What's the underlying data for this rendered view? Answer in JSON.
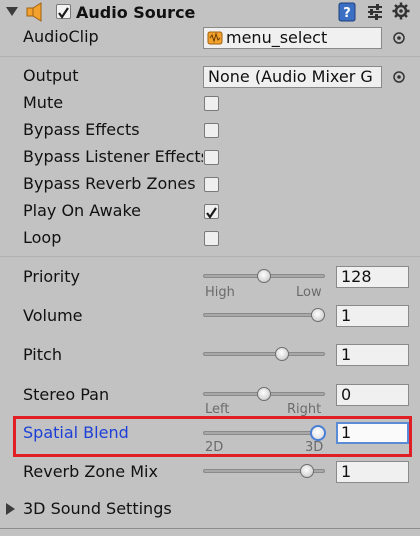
{
  "component": {
    "title": "Audio Source",
    "enabled": true
  },
  "fields": {
    "audio_clip": {
      "label": "AudioClip",
      "value": "menu_select"
    },
    "output": {
      "label": "Output",
      "value": "None (Audio Mixer G"
    },
    "mute": {
      "label": "Mute",
      "checked": false
    },
    "bypass_effects": {
      "label": "Bypass Effects",
      "checked": false
    },
    "bypass_listener_effects": {
      "label": "Bypass Listener Effects",
      "checked": false
    },
    "bypass_reverb_zones": {
      "label": "Bypass Reverb Zones",
      "checked": false
    },
    "play_on_awake": {
      "label": "Play On Awake",
      "checked": true
    },
    "loop": {
      "label": "Loop",
      "checked": false
    }
  },
  "sliders": {
    "priority": {
      "label": "Priority",
      "value": "128",
      "min_label": "High",
      "max_label": "Low",
      "fraction": 0.5
    },
    "volume": {
      "label": "Volume",
      "value": "1",
      "fraction": 1.0
    },
    "pitch": {
      "label": "Pitch",
      "value": "1",
      "fraction": 0.67
    },
    "stereo_pan": {
      "label": "Stereo Pan",
      "value": "0",
      "min_label": "Left",
      "max_label": "Right",
      "fraction": 0.5
    },
    "spatial_blend": {
      "label": "Spatial Blend",
      "value": "1",
      "min_label": "2D",
      "max_label": "3D",
      "fraction": 1.0
    },
    "reverb_zone_mix": {
      "label": "Reverb Zone Mix",
      "value": "1",
      "fraction": 0.9
    }
  },
  "foldout": {
    "label": "3D Sound Settings"
  },
  "colors": {
    "panel": "#c2c2c2",
    "highlight_border": "#e01e24",
    "active_label": "#1d3fd6",
    "active_focus": "#5b8ad6",
    "speaker_icon": "#f2a22c",
    "help_icon": "#3a6fc4"
  }
}
